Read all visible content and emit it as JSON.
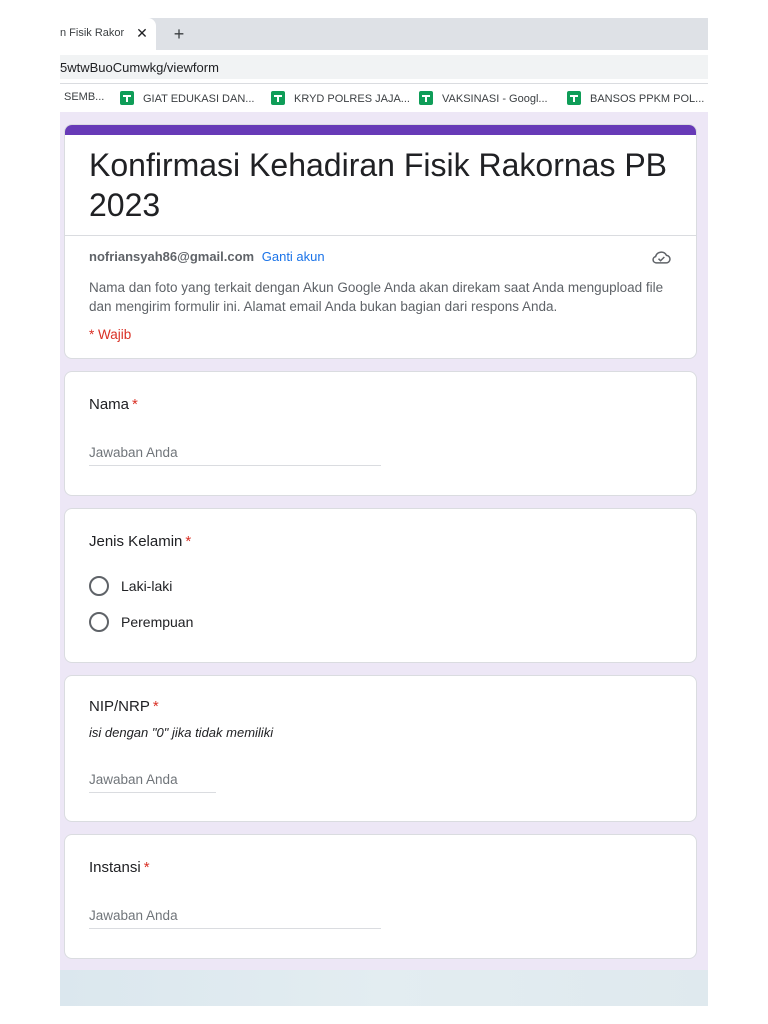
{
  "browser": {
    "tab_title": "n Fisik Rakor",
    "tab_close_glyph": "✕",
    "new_tab_glyph": "+",
    "url": "5wtwBuoCumwkg/viewform",
    "bookmarks": [
      {
        "label": "SEMB...",
        "icon": "none"
      },
      {
        "label": "GIAT EDUKASI DAN...",
        "icon": "google-sheets-icon"
      },
      {
        "label": "KRYD POLRES JAJA...",
        "icon": "google-sheets-icon"
      },
      {
        "label": "VAKSINASI - Googl...",
        "icon": "google-sheets-icon"
      },
      {
        "label": "BANSOS PPKM POL...",
        "icon": "google-sheets-icon"
      }
    ]
  },
  "form": {
    "accent_color": "#673ab7",
    "background_color": "#ede7f6",
    "required_color": "#d93025",
    "title": "Konfirmasi Kehadiran Fisik Rakornas PB 2023",
    "account_email": "nofriansyah86@gmail.com",
    "switch_account": "Ganti akun",
    "cloud_icon": "cloud-offline-icon",
    "notice": "Nama dan foto yang terkait dengan Akun Google Anda akan direkam saat Anda mengupload file dan mengirim formulir ini. Alamat email Anda bukan bagian dari respons Anda.",
    "required_note": "* Wajib",
    "required_star": "*",
    "questions": [
      {
        "title": "Nama",
        "type": "short",
        "placeholder": "Jawaban Anda"
      },
      {
        "title": "Jenis Kelamin",
        "type": "radio",
        "options": [
          "Laki-laki",
          "Perempuan"
        ]
      },
      {
        "title": "NIP/NRP",
        "type": "short",
        "help": "isi dengan \"0\" jika tidak memiliki",
        "placeholder": "Jawaban Anda"
      },
      {
        "title": "Instansi",
        "type": "short",
        "placeholder": "Jawaban Anda"
      }
    ]
  }
}
